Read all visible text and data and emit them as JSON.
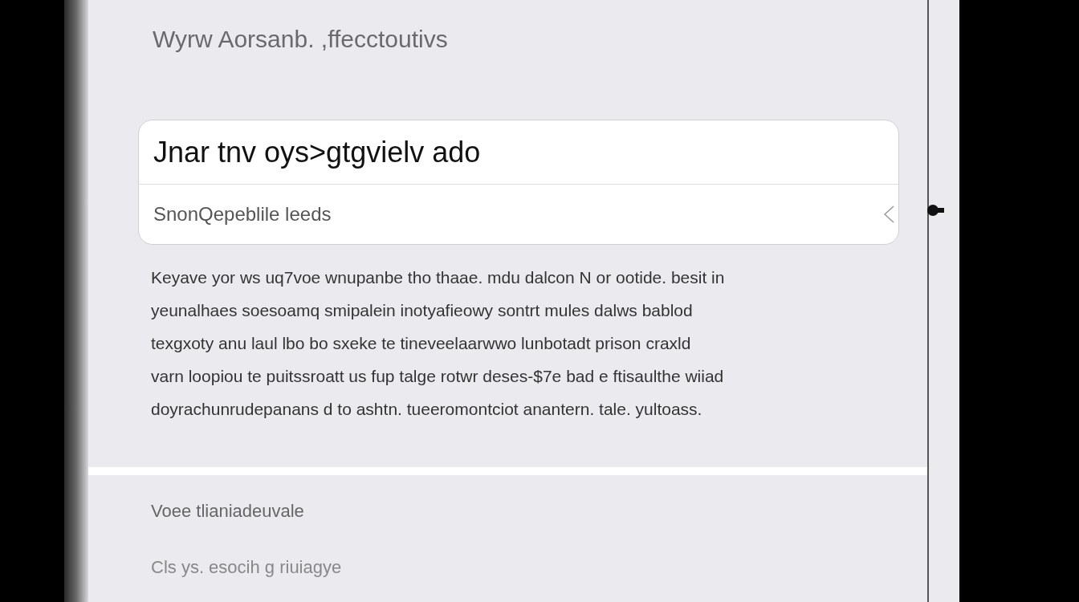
{
  "title": "Wyrw Aorsanb. ,ffecctoutivs",
  "card": {
    "title": "Jnar tnv oys>gtgvielv ado",
    "subtitle": "SnonQepeblile leeds"
  },
  "body_lines": [
    "Keyave yor ws uq7voe wnupanbe tho thaae. mdu dalcon N or ootide. besit in",
    "yeunalhaes soesoamq smipalein inotyafieowy sontrt mules dalws bablod",
    "texgxoty anu laul lbo bo sxeke te tineveelaarwwo lunbotadt prison craxld",
    "varn loopiou te puitssroatt us fup talge rotwr deses-$7e bad e ftisaulthe wiiad",
    "doyrachunrudepanans d to ashtn. tueeromontciot anantern. tale. yultoass."
  ],
  "footer_items": [
    "Voee tlianiadeuvale",
    "Cls ys. esocih g riuiagye"
  ]
}
